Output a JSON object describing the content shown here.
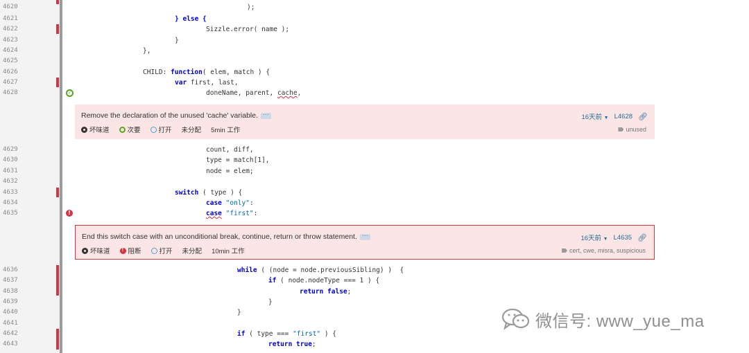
{
  "line_numbers": [
    "4620",
    "4621",
    "4622",
    "4623",
    "4624",
    "4625",
    "4626",
    "4627",
    "4628",
    "4629",
    "4630",
    "4631",
    "4632",
    "4633",
    "4634",
    "4635",
    "4636",
    "4637",
    "4638",
    "4639",
    "4640",
    "4641",
    "4642",
    "4643"
  ],
  "code": {
    "l4620": "",
    "l4621_kw": "} else {",
    "l4622": "Sizzle.error( name );",
    "l4623": "}",
    "l4624": "},",
    "l4626_a": "CHILD: ",
    "l4626_kw": "function",
    "l4626_b": "( elem, match ) {",
    "l4627_kw": "var",
    "l4627_b": " first, last,",
    "l4628_a": "doneName, parent, ",
    "l4628_sq": "cache",
    "l4628_b": ",",
    "l4629": "count, diff,",
    "l4630": "type = match[1],",
    "l4631": "node = elem;",
    "l4633_kw": "switch",
    "l4633_b": " ( type ) {",
    "l4634_kw": "case",
    "l4634_str": " \"only\"",
    "l4634_b": ":",
    "l4635_kw": "case",
    "l4635_str": " \"first\"",
    "l4635_b": ":",
    "l4636_kw": "while",
    "l4636_b": " ( (node = node.previousSibling) )  {",
    "l4637_kw": "if",
    "l4637_b": " ( node.nodeType === 1 ) {",
    "l4638_kw": "return false",
    "l4638_b": ";",
    "l4639": "}",
    "l4640": "}",
    "l4642_kw": "if",
    "l4642_b": " ( type === ",
    "l4642_str": "\"first\"",
    "l4642_c": " ) {",
    "l4643_kw": "return true",
    "l4643_b": ";"
  },
  "issues": [
    {
      "message": "Remove the declaration of the unused 'cache' variable.",
      "more": "···",
      "type": "坏味道",
      "severity": "次要",
      "status": "打开",
      "assignee": "未分配",
      "effort": "5min 工作",
      "age": "16天前",
      "line": "L4628",
      "tags": "unused"
    },
    {
      "message": "End this switch case with an unconditional break, continue, return or throw statement.",
      "more": "···",
      "type": "坏味道",
      "severity": "阻断",
      "status": "打开",
      "assignee": "未分配",
      "effort": "10min 工作",
      "age": "16天前",
      "line": "L4635",
      "tags": "cert, cwe, misra, suspicious"
    }
  ],
  "watermark": {
    "text": "微信号: www_yue_ma"
  },
  "colors": {
    "coverage_bar": "#d4333f",
    "issue_bg": "#fbe5e5",
    "link": "#236a97"
  }
}
